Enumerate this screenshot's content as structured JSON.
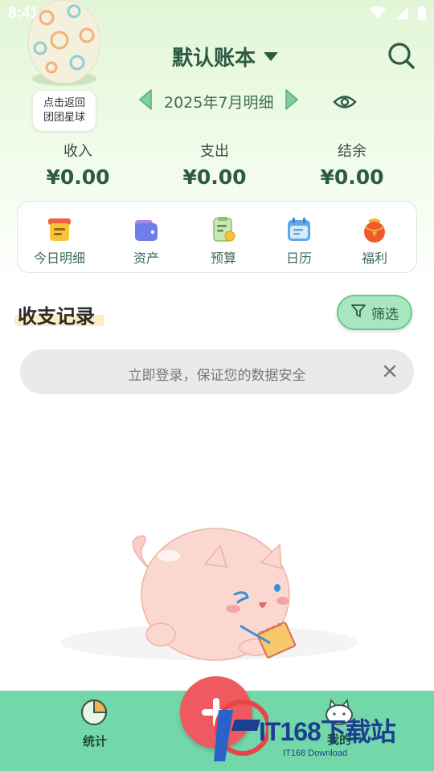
{
  "status_bar": {
    "time": "8:41"
  },
  "planet": {
    "label_line1": "点击返回",
    "label_line2": "团团星球"
  },
  "header": {
    "book_title": "默认账本",
    "month_label": "2025年7月明细"
  },
  "summary": [
    {
      "label": "收入",
      "value": "¥0.00"
    },
    {
      "label": "支出",
      "value": "¥0.00"
    },
    {
      "label": "结余",
      "value": "¥0.00"
    }
  ],
  "quick_actions": [
    {
      "label": "今日明细",
      "icon": "today-detail-icon"
    },
    {
      "label": "资产",
      "icon": "wallet-icon"
    },
    {
      "label": "预算",
      "icon": "budget-icon"
    },
    {
      "label": "日历",
      "icon": "calendar-icon"
    },
    {
      "label": "福利",
      "icon": "red-packet-icon"
    }
  ],
  "records": {
    "title": "收支记录",
    "filter_label": "筛选"
  },
  "login_banner": {
    "text": "立即登录，保证您的数据安全"
  },
  "tabbar": {
    "stats_label": "统计",
    "mine_label": "我的"
  },
  "watermark": {
    "main": "IT168下载站",
    "sub": "IT168 Download"
  },
  "colors": {
    "accent_green": "#72d8a9",
    "title_green": "#2d5a45",
    "add_red": "#ee5a5f",
    "filter_bg": "#a8e6bf"
  }
}
